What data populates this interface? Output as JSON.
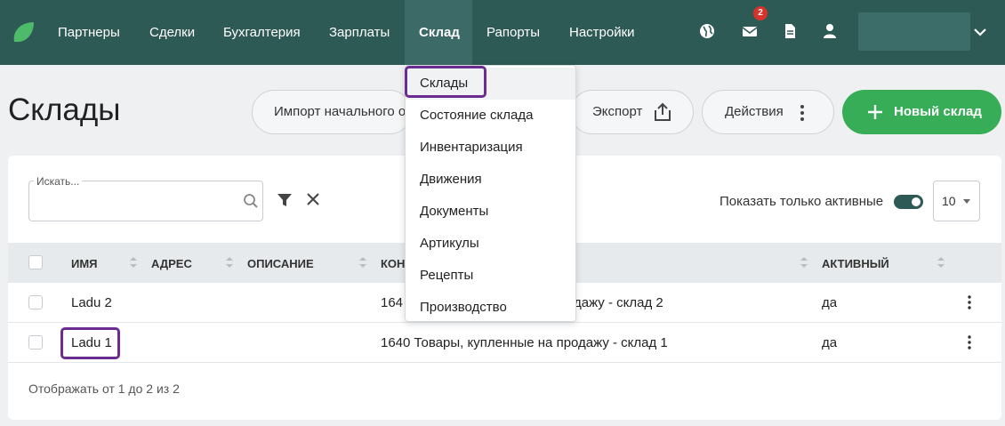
{
  "nav": {
    "items": [
      "Партнеры",
      "Сделки",
      "Бухгалтерия",
      "Зарплаты",
      "Склад",
      "Рапорты",
      "Настройки"
    ],
    "active_item": "Склад",
    "mail_badge": "2"
  },
  "page": {
    "title": "Склады",
    "import_label": "Импорт начального о",
    "export_label": "Экспорт",
    "actions_label": "Действия",
    "new_label": "Новый склад"
  },
  "dropdown": {
    "items": [
      "Склады",
      "Состояние склада",
      "Инвентаризация",
      "Движения",
      "Документы",
      "Артикулы",
      "Рецепты",
      "Производство"
    ],
    "selected": "Склады"
  },
  "filters": {
    "search_label": "Искать...",
    "search_value": "",
    "active_only_label": "Показать только активные",
    "active_only": true,
    "page_size": "10"
  },
  "table": {
    "headers": [
      "ИМЯ",
      "АДРЕС",
      "ОПИСАНИЕ",
      "КОН",
      "АКТИВНЫЙ"
    ],
    "rows": [
      {
        "name": "Ladu 2",
        "address": "",
        "description": "",
        "account": "164",
        "account_tail": "одажу - склад 2",
        "active": "да"
      },
      {
        "name": "Ladu 1",
        "address": "",
        "description": "",
        "account": "1640 Товары, купленные на продажу - склад 1",
        "active": "да"
      }
    ],
    "footer": "Отображать от 1 до 2 из 2"
  },
  "colors": {
    "nav_bg": "#2e5a56",
    "accent_green": "#36ad56",
    "highlight": "#6b2c91",
    "badge_red": "#d9322b"
  }
}
